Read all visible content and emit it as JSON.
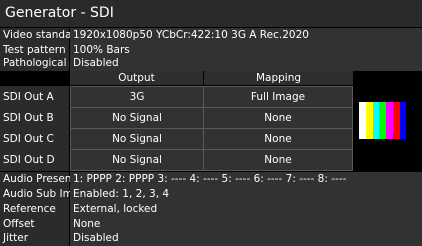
{
  "title": "Generator - SDI",
  "info": [
    {
      "label": "Video standard",
      "value": "1920x1080p50 YCbCr:422:10 3G A Rec.2020"
    },
    {
      "label": "Test pattern",
      "value": "100% Bars"
    },
    {
      "label": "Pathological",
      "value": "Disabled"
    }
  ],
  "mapping": {
    "headers": {
      "output": "Output",
      "mapping": "Mapping"
    },
    "rows": [
      {
        "label": "SDI Out A",
        "output": "3G",
        "mapping": "Full Image"
      },
      {
        "label": "SDI Out B",
        "output": "No Signal",
        "mapping": "None"
      },
      {
        "label": "SDI Out C",
        "output": "No Signal",
        "mapping": "None"
      },
      {
        "label": "SDI Out D",
        "output": "No Signal",
        "mapping": "None"
      }
    ]
  },
  "thumbnail": {
    "bar_colors": [
      "#ffffff",
      "#ffff00",
      "#00ffff",
      "#00ff00",
      "#ff00ff",
      "#ff0000",
      "#0000ff",
      "#000000"
    ]
  },
  "bottom": [
    {
      "label": "Audio Presence",
      "value": "1: PPPP 2: PPPP 3: ---- 4: ---- 5: ---- 6: ---- 7: ---- 8: ----"
    },
    {
      "label": "Audio Sub Images",
      "value": "Enabled: 1, 2, 3, 4"
    },
    {
      "label": "Reference",
      "value": "External, locked"
    },
    {
      "label": "Offset",
      "value": "None"
    },
    {
      "label": "Jitter",
      "value": "Disabled"
    }
  ]
}
